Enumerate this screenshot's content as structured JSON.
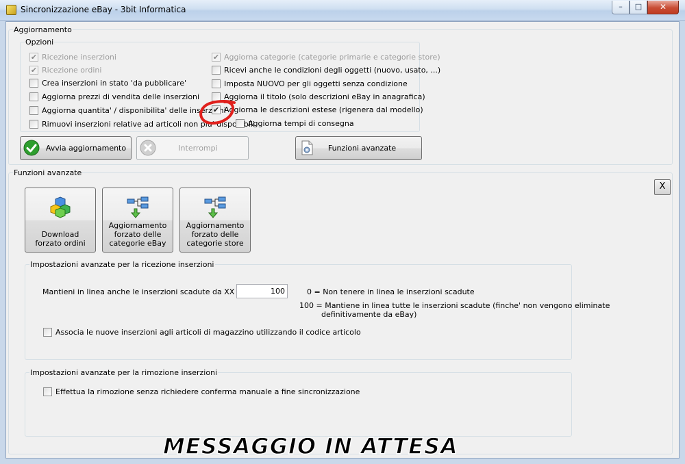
{
  "window": {
    "title": "Sincronizzazione eBay - 3bit Informatica",
    "controls": {
      "minimize": "–",
      "maximize": "□",
      "close": "✕"
    }
  },
  "aggiornamento": {
    "legend": "Aggiornamento",
    "opzioni": {
      "legend": "Opzioni",
      "left": [
        {
          "label": "Ricezione inserzioni",
          "checked": true,
          "disabled": true
        },
        {
          "label": "Ricezione ordini",
          "checked": true,
          "disabled": true
        },
        {
          "label": "Crea inserzioni in stato 'da pubblicare'",
          "checked": false,
          "disabled": false
        },
        {
          "label": "Aggiorna prezzi di vendita delle inserzioni",
          "checked": false,
          "disabled": false
        },
        {
          "label": "Aggiorna quantita' / disponibilita' delle inserzioni",
          "checked": false,
          "disabled": false
        },
        {
          "label": "Rimuovi inserzioni relative ad articoli non piu' disponibili",
          "checked": false,
          "disabled": false
        }
      ],
      "right": [
        {
          "label": "Aggiorna categorie (categorie primarie e categorie store)",
          "checked": true,
          "disabled": true
        },
        {
          "label": "Ricevi anche le condizioni degli oggetti (nuovo, usato, ...)",
          "checked": false,
          "disabled": false
        },
        {
          "label": "Imposta NUOVO per gli oggetti senza condizione",
          "checked": false,
          "disabled": false
        },
        {
          "label": "Aggiorna il titolo (solo descrizioni eBay in anagrafica)",
          "checked": false,
          "disabled": false
        },
        {
          "label": "Aggiorna le descrizioni estese (rigenera dal modello)",
          "checked": true,
          "disabled": false
        },
        {
          "label": "Aggiorna tempi di consegna",
          "checked": false,
          "disabled": false
        }
      ]
    },
    "buttons": {
      "start": "Avvia aggiornamento",
      "stop": "Interrompi",
      "advanced": "Funzioni avanzate"
    }
  },
  "funzioni_avanzate": {
    "legend": "Funzioni avanzate",
    "close_label": "X",
    "tools": [
      {
        "label": "Download forzato ordini",
        "icon": "cubes-icon"
      },
      {
        "label": "Aggiornamento forzato delle categorie eBay",
        "icon": "tree-download-icon"
      },
      {
        "label": "Aggiornamento forzato delle categorie store",
        "icon": "tree-download-icon"
      }
    ],
    "ricezione": {
      "legend": "Impostazioni avanzate per la ricezione inserzioni",
      "keep_label": "Mantieni in linea anche le inserzioni scadute da XX giorni",
      "keep_value": "100",
      "hint0": "0 =  Non tenere in linea le inserzioni scadute",
      "hint100": "100 =  Mantiene in linea tutte le inserzioni scadute (finche' non vengono eliminate",
      "hint100_cont": "definitivamente da eBay)",
      "associa_label": "Associa le nuove inserzioni agli articoli di magazzino utilizzando il codice articolo",
      "associa_checked": false
    },
    "rimozione": {
      "legend": "Impostazioni avanzate per la rimozione inserzioni",
      "effettua_label": "Effettua la rimozione senza richiedere conferma manuale a fine sincronizzazione",
      "effettua_checked": false
    }
  },
  "watermark": "MESSAGGIO IN ATTESA",
  "colors": {
    "annotation": "#e0201c",
    "accent_green": "#2e9e2e"
  }
}
